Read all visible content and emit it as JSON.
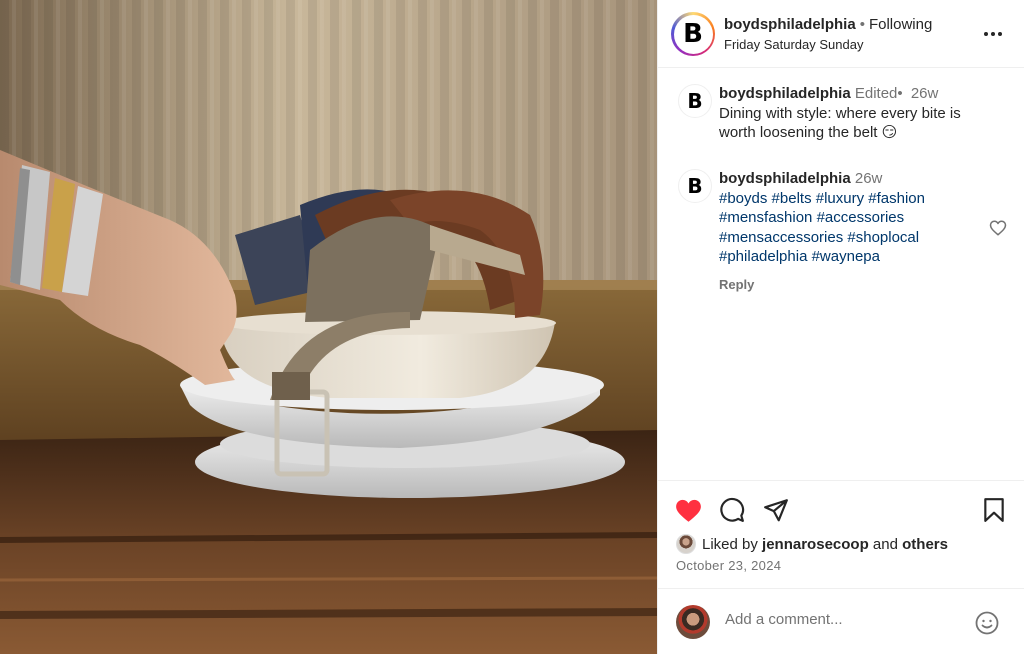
{
  "header": {
    "username": "boydsphiladelphia",
    "separator": "•",
    "follow_label": "Following",
    "subtitle": "Friday Saturday Sunday",
    "avatar_letter": "B"
  },
  "caption": {
    "avatar_letter": "B",
    "username": "boydsphiladelphia",
    "edited": "Edited",
    "separator": "•",
    "age": "26w",
    "text": "Dining with style: where every bite is worth loosening the belt 😏"
  },
  "tags_comment": {
    "avatar_letter": "B",
    "username": "boydsphiladelphia",
    "age": "26w",
    "hashtags": [
      "#boyds",
      "#belts",
      "#luxury",
      "#fashion",
      "#mensfashion",
      "#accessories",
      "#mensaccessories",
      "#shoplocal",
      "#philadelphia",
      "#waynepa"
    ],
    "reply_label": "Reply"
  },
  "likes": {
    "prefix": "Liked by",
    "user": "jennarosecoop",
    "middle": "and",
    "others": "others"
  },
  "date": "October 23, 2024",
  "add_comment": {
    "placeholder": "Add a comment..."
  },
  "icons": {
    "like": "heart-filled-icon",
    "comment": "comment-bubble-icon",
    "share": "paper-plane-icon",
    "save": "bookmark-icon",
    "more": "more-dots-icon",
    "comment_like": "heart-outline-icon",
    "emoji": "emoji-smile-icon"
  },
  "colors": {
    "like_red": "#ff3040",
    "hashtag_blue": "#00376b",
    "secondary_text": "#737373"
  }
}
